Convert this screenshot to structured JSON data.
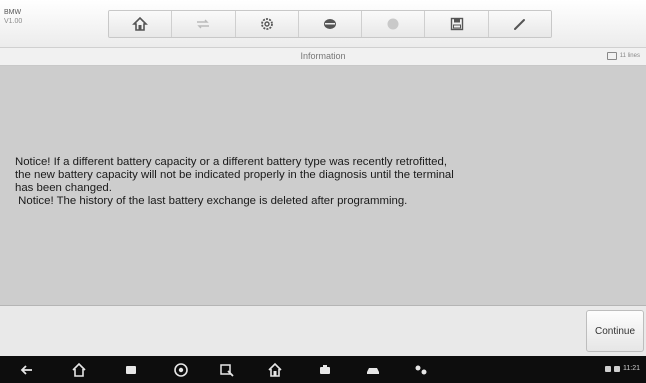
{
  "app": {
    "brand": "BMW",
    "version": "V1.00"
  },
  "toolbar": {
    "icons": [
      "home-icon",
      "vehicle-swap-icon",
      "settings-icon",
      "print-icon",
      "help-icon",
      "save-icon",
      "edit-icon"
    ]
  },
  "titlebar": {
    "title": "Information",
    "badge": "11 lines"
  },
  "message": {
    "line1": "Notice! If a different battery capacity or a different battery type was recently retrofitted,",
    "line2": "the new battery capacity will not be indicated properly in the diagnosis until the terminal",
    "line3": "has been changed.",
    "line4": " Notice! The history of the last battery exchange is deleted after programming."
  },
  "footer": {
    "continue_label": "Continue"
  },
  "navbar": {
    "icons": [
      "back-icon",
      "home-icon",
      "recent-apps-icon",
      "browser-icon",
      "screenshot-icon",
      "autel-home-icon",
      "vci-icon",
      "car-icon",
      "settings-multi-icon"
    ],
    "status_text": "11:21"
  },
  "colors": {
    "panel_bg": "#cdcdcd",
    "navbar_bg": "#0d0d0d",
    "toolbar_bg": "#ececec"
  }
}
